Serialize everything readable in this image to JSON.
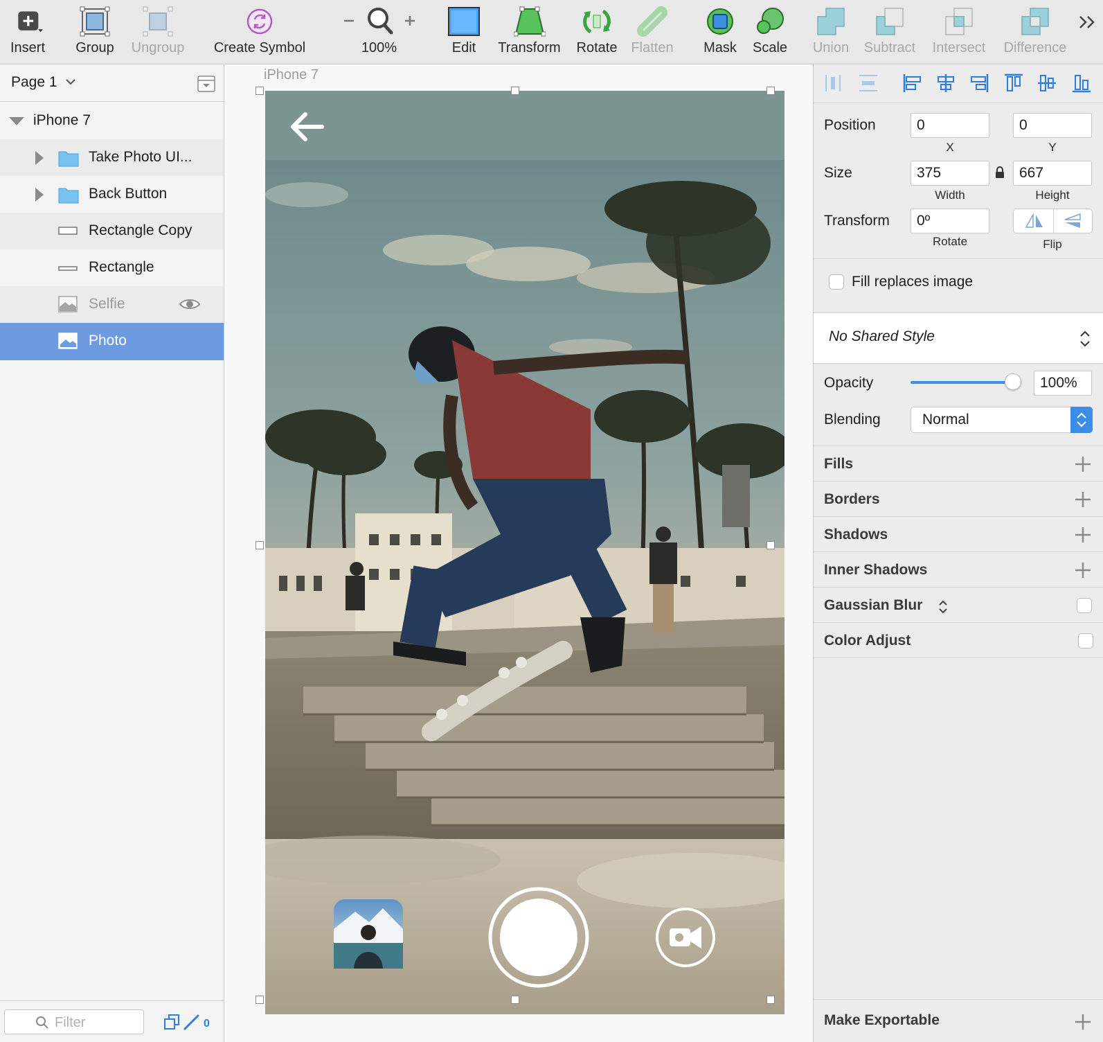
{
  "toolbar": {
    "insert": "Insert",
    "group": "Group",
    "ungroup": "Ungroup",
    "create_symbol": "Create Symbol",
    "zoom": "100%",
    "edit": "Edit",
    "transform": "Transform",
    "rotate": "Rotate",
    "flatten": "Flatten",
    "mask": "Mask",
    "scale": "Scale",
    "union": "Union",
    "subtract": "Subtract",
    "intersect": "Intersect",
    "difference": "Difference"
  },
  "layers": {
    "page": "Page 1",
    "artboard": "iPhone 7",
    "items": [
      {
        "label": "Take Photo UI...",
        "kind": "folder-icon"
      },
      {
        "label": "Back Button",
        "kind": "folder-icon"
      },
      {
        "label": "Rectangle Copy",
        "kind": "rectangle-icon"
      },
      {
        "label": "Rectangle",
        "kind": "rectangle-icon"
      },
      {
        "label": "Selfie",
        "kind": "image-icon"
      },
      {
        "label": "Photo",
        "kind": "image-icon"
      }
    ],
    "filter_placeholder": "Filter",
    "filter_count": "0"
  },
  "canvas": {
    "artboard_label": "iPhone 7"
  },
  "inspector": {
    "position_label": "Position",
    "x": "0",
    "y": "0",
    "x_label": "X",
    "y_label": "Y",
    "size_label": "Size",
    "width": "375",
    "height": "667",
    "width_label": "Width",
    "height_label": "Height",
    "transform_label": "Transform",
    "rotate_value": "0º",
    "rotate_label": "Rotate",
    "flip_label": "Flip",
    "fill_replaces": "Fill replaces image",
    "shared_style": "No Shared Style",
    "opacity_label": "Opacity",
    "opacity_value": "100%",
    "opacity_level": 1.0,
    "blending_label": "Blending",
    "blending_value": "Normal",
    "sections": [
      "Fills",
      "Borders",
      "Shadows",
      "Inner Shadows",
      "Gaussian Blur",
      "Color Adjust"
    ],
    "make_exportable": "Make Exportable"
  },
  "colors": {
    "accent": "#3b8de8",
    "selection": "#6d9be0",
    "folder": "#79c1f1"
  }
}
